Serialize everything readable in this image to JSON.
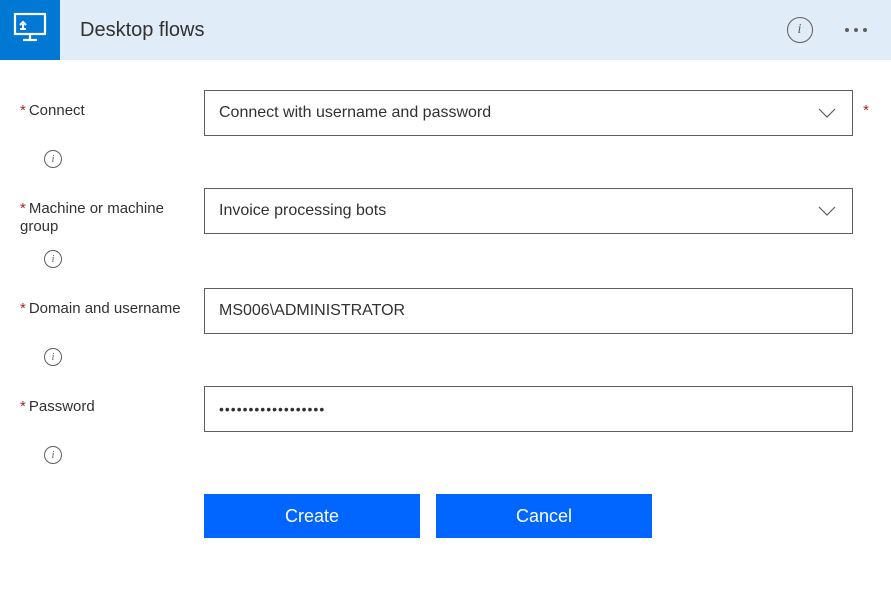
{
  "header": {
    "title": "Desktop flows"
  },
  "form": {
    "connect": {
      "label": "Connect",
      "value": "Connect with username and password"
    },
    "machine": {
      "label": "Machine or machine group",
      "value": "Invoice processing bots"
    },
    "domain": {
      "label": "Domain and username",
      "value": "MS006\\ADMINISTRATOR"
    },
    "password": {
      "label": "Password",
      "value": "••••••••••••••••••"
    }
  },
  "buttons": {
    "create": "Create",
    "cancel": "Cancel"
  }
}
